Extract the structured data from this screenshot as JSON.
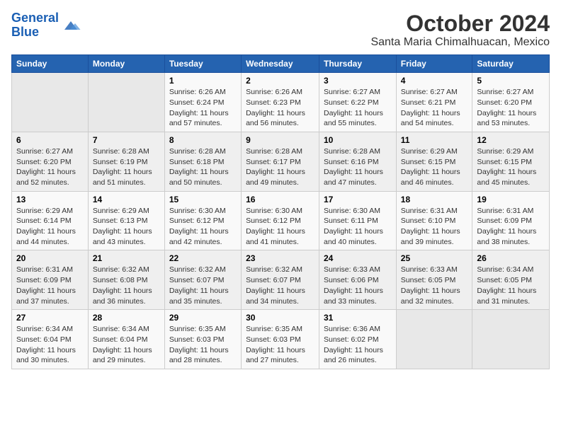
{
  "header": {
    "logo_general": "General",
    "logo_blue": "Blue",
    "title": "October 2024",
    "subtitle": "Santa Maria Chimalhuacan, Mexico"
  },
  "weekdays": [
    "Sunday",
    "Monday",
    "Tuesday",
    "Wednesday",
    "Thursday",
    "Friday",
    "Saturday"
  ],
  "weeks": [
    [
      {
        "day": "",
        "data": ""
      },
      {
        "day": "",
        "data": ""
      },
      {
        "day": "1",
        "data": "Sunrise: 6:26 AM\nSunset: 6:24 PM\nDaylight: 11 hours and 57 minutes."
      },
      {
        "day": "2",
        "data": "Sunrise: 6:26 AM\nSunset: 6:23 PM\nDaylight: 11 hours and 56 minutes."
      },
      {
        "day": "3",
        "data": "Sunrise: 6:27 AM\nSunset: 6:22 PM\nDaylight: 11 hours and 55 minutes."
      },
      {
        "day": "4",
        "data": "Sunrise: 6:27 AM\nSunset: 6:21 PM\nDaylight: 11 hours and 54 minutes."
      },
      {
        "day": "5",
        "data": "Sunrise: 6:27 AM\nSunset: 6:20 PM\nDaylight: 11 hours and 53 minutes."
      }
    ],
    [
      {
        "day": "6",
        "data": "Sunrise: 6:27 AM\nSunset: 6:20 PM\nDaylight: 11 hours and 52 minutes."
      },
      {
        "day": "7",
        "data": "Sunrise: 6:28 AM\nSunset: 6:19 PM\nDaylight: 11 hours and 51 minutes."
      },
      {
        "day": "8",
        "data": "Sunrise: 6:28 AM\nSunset: 6:18 PM\nDaylight: 11 hours and 50 minutes."
      },
      {
        "day": "9",
        "data": "Sunrise: 6:28 AM\nSunset: 6:17 PM\nDaylight: 11 hours and 49 minutes."
      },
      {
        "day": "10",
        "data": "Sunrise: 6:28 AM\nSunset: 6:16 PM\nDaylight: 11 hours and 47 minutes."
      },
      {
        "day": "11",
        "data": "Sunrise: 6:29 AM\nSunset: 6:15 PM\nDaylight: 11 hours and 46 minutes."
      },
      {
        "day": "12",
        "data": "Sunrise: 6:29 AM\nSunset: 6:15 PM\nDaylight: 11 hours and 45 minutes."
      }
    ],
    [
      {
        "day": "13",
        "data": "Sunrise: 6:29 AM\nSunset: 6:14 PM\nDaylight: 11 hours and 44 minutes."
      },
      {
        "day": "14",
        "data": "Sunrise: 6:29 AM\nSunset: 6:13 PM\nDaylight: 11 hours and 43 minutes."
      },
      {
        "day": "15",
        "data": "Sunrise: 6:30 AM\nSunset: 6:12 PM\nDaylight: 11 hours and 42 minutes."
      },
      {
        "day": "16",
        "data": "Sunrise: 6:30 AM\nSunset: 6:12 PM\nDaylight: 11 hours and 41 minutes."
      },
      {
        "day": "17",
        "data": "Sunrise: 6:30 AM\nSunset: 6:11 PM\nDaylight: 11 hours and 40 minutes."
      },
      {
        "day": "18",
        "data": "Sunrise: 6:31 AM\nSunset: 6:10 PM\nDaylight: 11 hours and 39 minutes."
      },
      {
        "day": "19",
        "data": "Sunrise: 6:31 AM\nSunset: 6:09 PM\nDaylight: 11 hours and 38 minutes."
      }
    ],
    [
      {
        "day": "20",
        "data": "Sunrise: 6:31 AM\nSunset: 6:09 PM\nDaylight: 11 hours and 37 minutes."
      },
      {
        "day": "21",
        "data": "Sunrise: 6:32 AM\nSunset: 6:08 PM\nDaylight: 11 hours and 36 minutes."
      },
      {
        "day": "22",
        "data": "Sunrise: 6:32 AM\nSunset: 6:07 PM\nDaylight: 11 hours and 35 minutes."
      },
      {
        "day": "23",
        "data": "Sunrise: 6:32 AM\nSunset: 6:07 PM\nDaylight: 11 hours and 34 minutes."
      },
      {
        "day": "24",
        "data": "Sunrise: 6:33 AM\nSunset: 6:06 PM\nDaylight: 11 hours and 33 minutes."
      },
      {
        "day": "25",
        "data": "Sunrise: 6:33 AM\nSunset: 6:05 PM\nDaylight: 11 hours and 32 minutes."
      },
      {
        "day": "26",
        "data": "Sunrise: 6:34 AM\nSunset: 6:05 PM\nDaylight: 11 hours and 31 minutes."
      }
    ],
    [
      {
        "day": "27",
        "data": "Sunrise: 6:34 AM\nSunset: 6:04 PM\nDaylight: 11 hours and 30 minutes."
      },
      {
        "day": "28",
        "data": "Sunrise: 6:34 AM\nSunset: 6:04 PM\nDaylight: 11 hours and 29 minutes."
      },
      {
        "day": "29",
        "data": "Sunrise: 6:35 AM\nSunset: 6:03 PM\nDaylight: 11 hours and 28 minutes."
      },
      {
        "day": "30",
        "data": "Sunrise: 6:35 AM\nSunset: 6:03 PM\nDaylight: 11 hours and 27 minutes."
      },
      {
        "day": "31",
        "data": "Sunrise: 6:36 AM\nSunset: 6:02 PM\nDaylight: 11 hours and 26 minutes."
      },
      {
        "day": "",
        "data": ""
      },
      {
        "day": "",
        "data": ""
      }
    ]
  ]
}
